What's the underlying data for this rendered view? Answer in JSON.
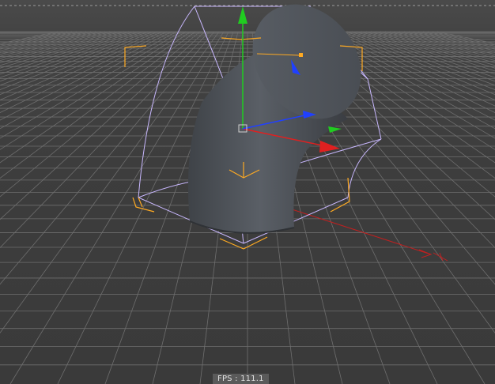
{
  "viewport": {
    "fps_label": "FPS",
    "fps_separator": " : ",
    "fps_value": "111.1"
  },
  "colors": {
    "background": "#3c3c3c",
    "grid": "#7a7a7a",
    "bounding_box": "#c9b8ff",
    "selection_brackets": "#ffaa22",
    "axis_x": "#e02020",
    "axis_y": "#20cc20",
    "axis_z": "#2040ff",
    "object_surface": "#50555c"
  },
  "icons": {
    "move_gizmo": "move-gizmo-icon",
    "world_axis": "world-axis-icon"
  }
}
